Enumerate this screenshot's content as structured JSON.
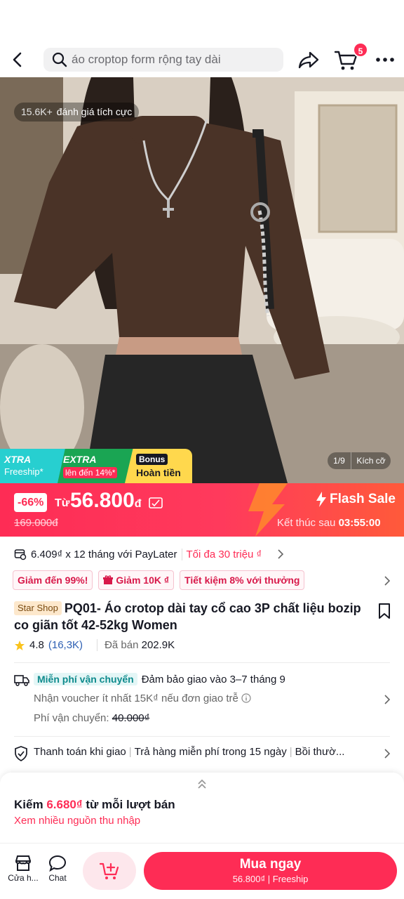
{
  "header": {
    "search_placeholder": "áo croptop form rộng tay dài",
    "cart_count": "5"
  },
  "hero": {
    "review_count": "15.6K+",
    "review_text": "đánh giá tích cực",
    "image_index": "1/9",
    "size_label": "Kích cỡ"
  },
  "badges": {
    "xtra_title": "XTRA",
    "xtra_sub": "Freeship*",
    "extra_title": "EXTRA",
    "extra_sub": "lên đến 14%*",
    "bonus_title": "Bonus",
    "bonus_sub": "Hoàn tiền"
  },
  "price": {
    "discount": "-66%",
    "from_label": "Từ",
    "value": "56.800",
    "currency": "đ",
    "original": "169.000đ",
    "flash_label": "Flash Sale",
    "ends_label": "Kết thúc sau",
    "ends_time": "03:55:00"
  },
  "paylater": {
    "text": "6.409₫ x 12 tháng với PayLater",
    "cap": "Tối đa 30 triệu ₫"
  },
  "promos": [
    "Giảm đến 99%!",
    "Giảm 10K ₫",
    "Tiết kiệm 8% với thưởng"
  ],
  "product": {
    "shop_tag": "Star Shop",
    "title": "PQ01- Áo crotop dài tay cổ cao 3P chất liệu bozip co giãn tốt 42-52kg Women",
    "rating": "4.8",
    "rating_count": "(16,3K)",
    "sold_label": "Đã bán",
    "sold_value": "202.9K"
  },
  "shipping": {
    "free_tag": "Miễn phí vận chuyển",
    "guarantee": "Đảm bảo giao vào 3–7 tháng 9",
    "voucher": "Nhận voucher ít nhất 15K₫ nếu đơn giao trễ",
    "fee_label": "Phí vận chuyển:",
    "fee_value": "40.000₫"
  },
  "guarantees": [
    "Thanh toán khi giao",
    "Trả hàng miễn phí trong 15 ngày",
    "Bồi thườ..."
  ],
  "earn": {
    "prefix": "Kiếm",
    "amount": "6.680₫",
    "suffix": "từ mỗi lượt bán",
    "link": "Xem nhiều nguồn thu nhập"
  },
  "bottom_bar": {
    "shop_label": "Cửa h...",
    "chat_label": "Chat",
    "buy_label": "Mua ngay",
    "buy_price": "56.800₫",
    "buy_ship": "Freeship"
  },
  "colors": {
    "accent": "#fe2c55",
    "teal": "#27cfd0",
    "green": "#1aa553",
    "yellow": "#ffd84d"
  }
}
